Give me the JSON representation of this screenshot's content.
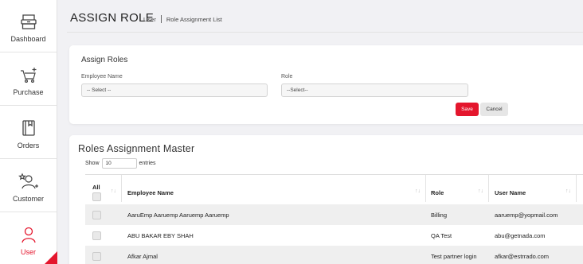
{
  "sidebar": {
    "items": [
      {
        "label": "Dashboard",
        "icon": "dashboard-icon"
      },
      {
        "label": "Purchase",
        "icon": "cart-icon"
      },
      {
        "label": "Orders",
        "icon": "orders-icon"
      },
      {
        "label": "Customer",
        "icon": "customer-icon"
      },
      {
        "label": "User",
        "icon": "user-icon",
        "active": true
      }
    ]
  },
  "header": {
    "title": "ASSIGN ROLE",
    "breadcrumb": [
      "User",
      "Role Assignment List"
    ]
  },
  "assign": {
    "title": "Assign Roles",
    "employee_label": "Employee Name",
    "employee_value": "-- Select --",
    "role_label": "Role",
    "role_value": "--Select--",
    "save_label": "Save",
    "cancel_label": "Cancel"
  },
  "master": {
    "title": "Roles Assignment Master",
    "show_label": "Show",
    "entries_value": "10",
    "entries_label": "entries",
    "columns": [
      "All",
      "Employee Name",
      "Role",
      "User Name"
    ],
    "rows": [
      {
        "employee": "AaruEmp Aaruemp Aaruemp Aaruemp",
        "role": "Billing",
        "username": "aaruemp@yopmail.com"
      },
      {
        "employee": "ABU BAKAR EBY SHAH",
        "role": "QA Test",
        "username": "abu@getnada.com"
      },
      {
        "employee": "Afkar Ajmal",
        "role": "Test partner login",
        "username": "afkar@estrrado.com"
      }
    ]
  },
  "colors": {
    "accent": "#e4162d",
    "background": "#f1f1f4"
  }
}
